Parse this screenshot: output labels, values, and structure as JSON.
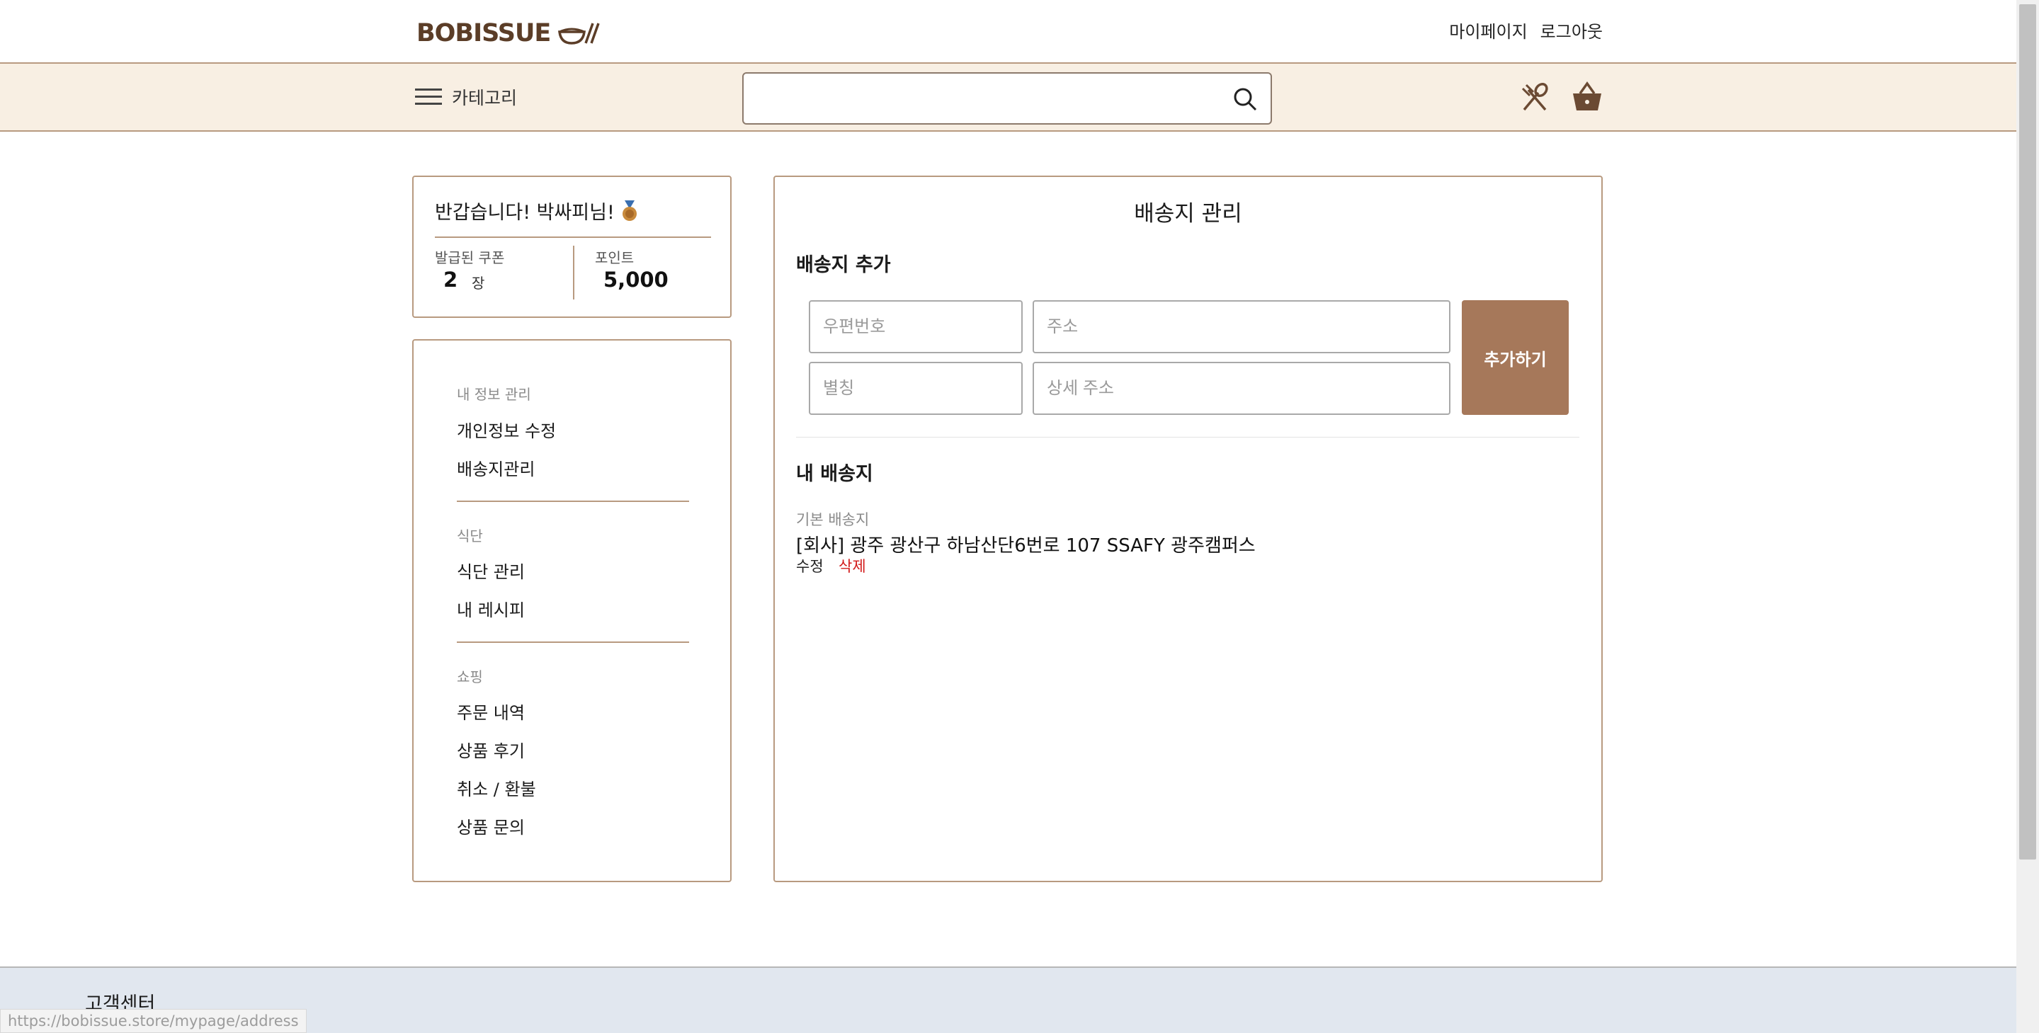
{
  "header": {
    "logo_text": "BOBISSUE",
    "links": {
      "mypage": "마이페이지",
      "logout": "로그아웃"
    }
  },
  "category_bar": {
    "category_label": "카테고리",
    "search_placeholder": ""
  },
  "greeting": {
    "title": "반갑습니다! 박싸피님!",
    "coupon_label": "발급된 쿠폰",
    "coupon_count": "2",
    "coupon_unit": "장",
    "point_label": "포인트",
    "point_value": "5,000"
  },
  "sidebar": {
    "sections": [
      {
        "heading": "내 정보 관리",
        "items": [
          "개인정보 수정",
          "배송지관리"
        ]
      },
      {
        "heading": "식단",
        "items": [
          "식단 관리",
          "내 레시피"
        ]
      },
      {
        "heading": "쇼핑",
        "items": [
          "주문 내역",
          "상품 후기",
          "취소 / 환불",
          "상품 문의"
        ]
      }
    ]
  },
  "main": {
    "title": "배송지 관리",
    "add_section_title": "배송지 추가",
    "form": {
      "zipcode_placeholder": "우편번호",
      "address_placeholder": "주소",
      "alias_placeholder": "별칭",
      "detail_placeholder": "상세 주소",
      "add_button": "추가하기"
    },
    "my_section_title": "내 배송지",
    "addresses": [
      {
        "badge": "기본 배송지",
        "text": "[회사] 광주 광산구 하남산단6번로 107 SSAFY 광주캠퍼스",
        "edit": "수정",
        "delete": "삭제"
      }
    ]
  },
  "footer": {
    "title": "고객센터"
  },
  "status_bar": {
    "url": "https://bobissue.store/mypage/address"
  },
  "colors": {
    "brand_brown": "#5b3d27",
    "button_brown": "#a6785a",
    "bar_beige": "#f8efe3",
    "delete_red": "#d21a1a"
  }
}
